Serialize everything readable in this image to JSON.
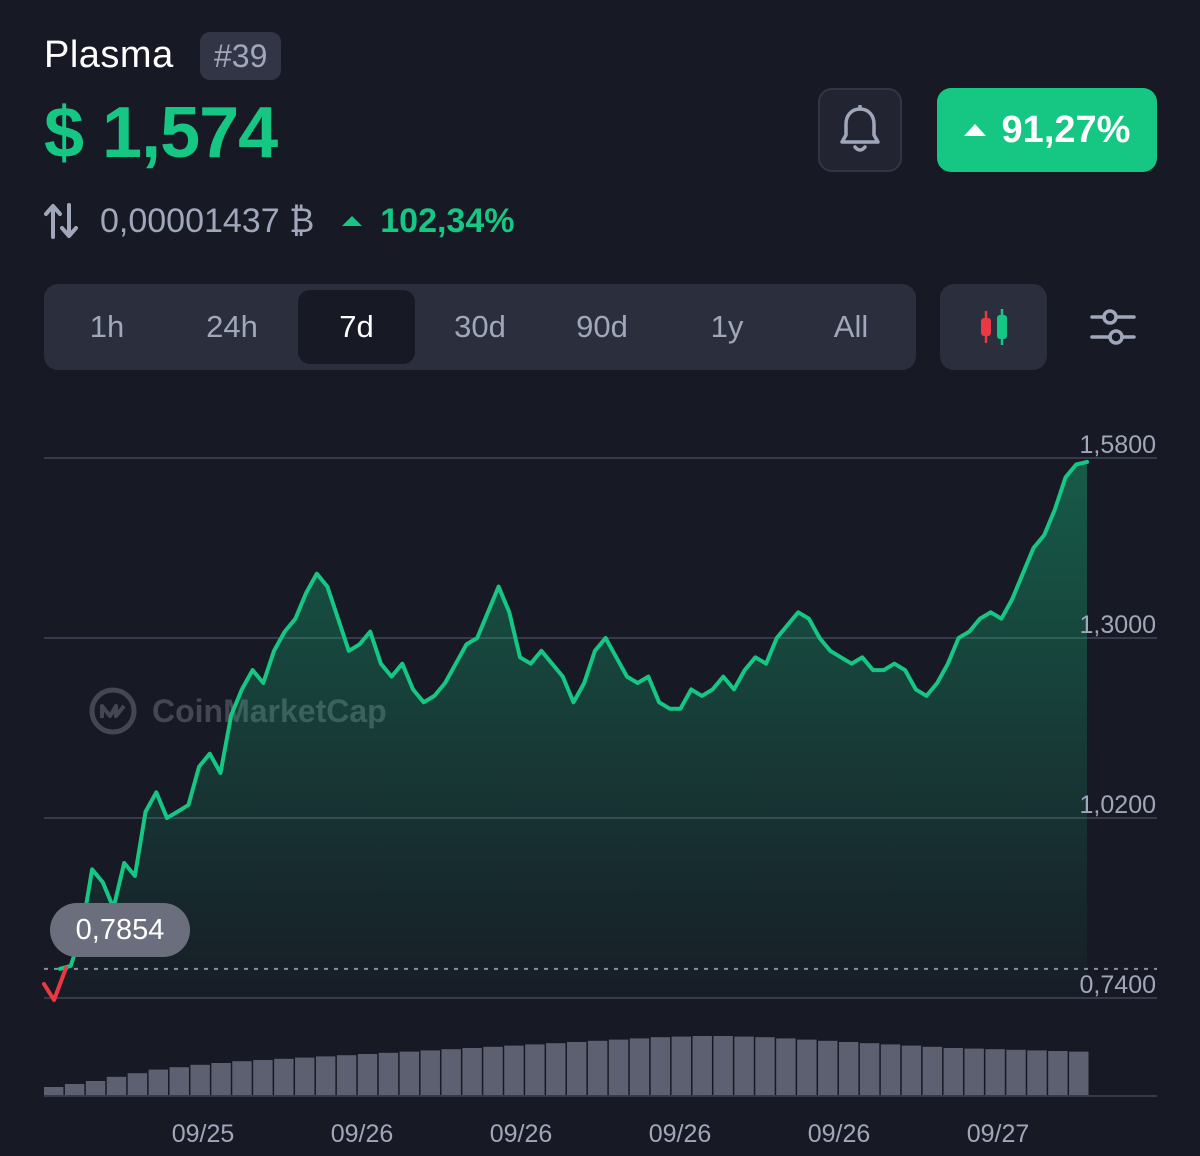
{
  "coin": {
    "name": "Plasma",
    "rank": "#39",
    "price": "$ 1,574"
  },
  "alert": {
    "icon": "bell-icon"
  },
  "change_badge": {
    "value": "91,27%",
    "direction": "up",
    "color": "#16c784"
  },
  "btc_row": {
    "icon": "swap-arrows-icon",
    "value": "0,00001437 ₿",
    "change": "102,34%"
  },
  "ranges": [
    {
      "label": "1h",
      "active": false
    },
    {
      "label": "24h",
      "active": false
    },
    {
      "label": "7d",
      "active": true
    },
    {
      "label": "30d",
      "active": false
    },
    {
      "label": "90d",
      "active": false
    },
    {
      "label": "1y",
      "active": false
    },
    {
      "label": "All",
      "active": false
    }
  ],
  "toolbar": {
    "candle_icon": "candlestick-icon",
    "settings_icon": "sliders-icon"
  },
  "watermark": {
    "text": "CoinMarketCap",
    "icon": "coinmarketcap-logo-icon"
  },
  "start_label": "0,7854",
  "colors": {
    "up": "#16c784",
    "down": "#ea3943",
    "background": "#171924"
  },
  "chart_data": {
    "type": "area",
    "y_ticks": [
      "1,5800",
      "1,3000",
      "1,0200",
      "0,7400"
    ],
    "x_ticks": [
      "09/25",
      "09/26",
      "09/26",
      "09/26",
      "09/26",
      "09/27"
    ],
    "ylim": [
      0.74,
      1.58
    ],
    "grid": true,
    "start_value": 0.7854,
    "values": [
      0.79,
      0.84,
      0.94,
      0.92,
      0.88,
      0.95,
      0.93,
      1.03,
      1.06,
      1.02,
      1.03,
      1.04,
      1.1,
      1.12,
      1.09,
      1.18,
      1.22,
      1.25,
      1.23,
      1.28,
      1.31,
      1.33,
      1.37,
      1.4,
      1.38,
      1.33,
      1.28,
      1.29,
      1.31,
      1.26,
      1.24,
      1.26,
      1.22,
      1.2,
      1.21,
      1.23,
      1.26,
      1.29,
      1.3,
      1.34,
      1.38,
      1.34,
      1.27,
      1.26,
      1.28,
      1.26,
      1.24,
      1.2,
      1.23,
      1.28,
      1.3,
      1.27,
      1.24,
      1.23,
      1.24,
      1.2,
      1.19,
      1.19,
      1.22,
      1.21,
      1.22,
      1.24,
      1.22,
      1.25,
      1.27,
      1.26,
      1.3,
      1.32,
      1.34,
      1.33,
      1.3,
      1.28,
      1.27,
      1.26,
      1.27,
      1.25,
      1.25,
      1.26,
      1.25,
      1.22,
      1.21,
      1.23,
      1.26,
      1.3,
      1.31,
      1.33,
      1.34,
      1.33,
      1.36,
      1.4,
      1.44,
      1.46,
      1.5,
      1.55,
      1.57,
      1.574
    ]
  },
  "volume_data": {
    "values": [
      0.15,
      0.2,
      0.25,
      0.32,
      0.38,
      0.44,
      0.48,
      0.52,
      0.55,
      0.58,
      0.6,
      0.62,
      0.64,
      0.66,
      0.68,
      0.7,
      0.72,
      0.74,
      0.76,
      0.78,
      0.8,
      0.82,
      0.84,
      0.86,
      0.88,
      0.9,
      0.92,
      0.94,
      0.96,
      0.98,
      0.99,
      1.0,
      1.0,
      0.99,
      0.98,
      0.96,
      0.94,
      0.92,
      0.9,
      0.88,
      0.86,
      0.84,
      0.82,
      0.8,
      0.79,
      0.78,
      0.77,
      0.76,
      0.75,
      0.74
    ]
  }
}
